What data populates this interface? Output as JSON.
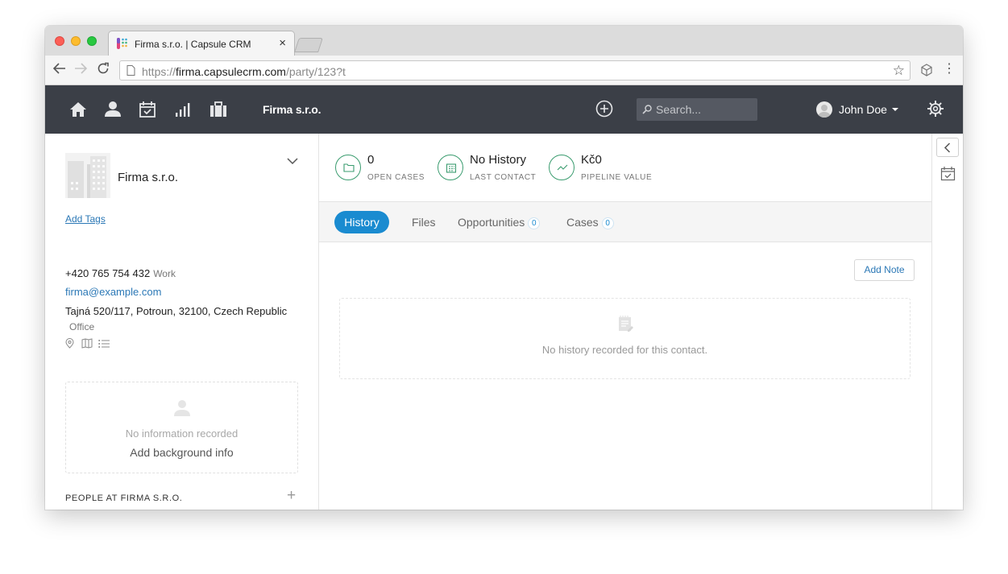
{
  "browser": {
    "tab_title": "Firma s.r.o. | Capsule CRM",
    "url_scheme": "https://",
    "url_host": "firma.capsulecrm.com",
    "url_path": "/party/123?t",
    "icons": [
      "back-icon",
      "forward-icon",
      "reload-icon",
      "page-icon",
      "star-icon",
      "extension-icon",
      "menu-icon"
    ]
  },
  "header": {
    "nav_icons": [
      "home-icon",
      "person-icon",
      "calendar-icon",
      "chart-icon",
      "briefcase-icon"
    ],
    "title": "Firma s.r.o.",
    "search_placeholder": "Search...",
    "user_name": "John Doe",
    "background_color": "#3b3f47"
  },
  "sidebar": {
    "org_name": "Firma s.r.o.",
    "add_tags_label": "Add Tags",
    "phone": "+420 765 754 432",
    "phone_type": "Work",
    "email": "firma@example.com",
    "address": "Tajná 520/117, Potroun, 32100, Czech Republic",
    "address_type": "Office",
    "background": {
      "empty_text": "No information recorded",
      "add_label": "Add background info"
    },
    "people_title": "PEOPLE AT FIRMA S.R.O."
  },
  "stats": [
    {
      "value": "0",
      "label": "OPEN CASES",
      "icon": "folder-icon"
    },
    {
      "value": "No History",
      "label": "LAST CONTACT",
      "icon": "calendar-icon"
    },
    {
      "value": "Kč0",
      "label": "PIPELINE VALUE",
      "icon": "trend-icon"
    }
  ],
  "tabs": [
    {
      "label": "History",
      "active": true
    },
    {
      "label": "Files"
    },
    {
      "label": "Opportunities",
      "count": "0"
    },
    {
      "label": "Cases",
      "count": "0"
    }
  ],
  "history": {
    "add_note_label": "Add Note",
    "empty_text": "No history recorded for this contact."
  },
  "colors": {
    "accent": "#1a8bd0",
    "link": "#2b78b6",
    "stat_ring": "#3a9c6f"
  }
}
